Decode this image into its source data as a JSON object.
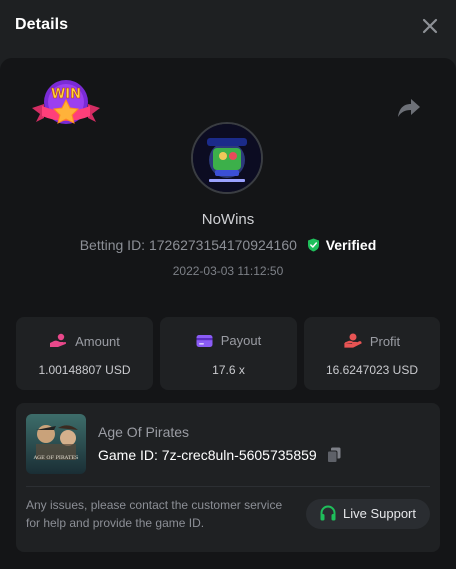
{
  "header": {
    "title": "Details"
  },
  "bet": {
    "username": "NoWins",
    "betting_id_label": "Betting ID:",
    "betting_id": "1726273154170924160",
    "verified_label": "Verified",
    "timestamp": "2022-03-03 11:12:50",
    "badge_text": "WIN"
  },
  "stats": [
    {
      "label": "Amount",
      "value": "1.00148807 USD",
      "icon": "money-hand-icon",
      "color": "#e8488a"
    },
    {
      "label": "Payout",
      "value": "17.6 x",
      "icon": "card-icon",
      "color": "#8b5cf6"
    },
    {
      "label": "Profit",
      "value": "16.6247023 USD",
      "icon": "profit-hand-icon",
      "color": "#e85454"
    }
  ],
  "game": {
    "name": "Age Of Pirates",
    "id_label": "Game ID:",
    "id": "7z-crec8uln-5605735859",
    "thumb_text": "AGE OF PIRATES",
    "help_text": "Any issues, please contact the customer service for help and provide the game ID.",
    "support_label": "Live Support"
  },
  "colors": {
    "verified": "#1fbf5b",
    "support": "#1fbf5b",
    "panel": "#141517",
    "card": "#1f2123"
  }
}
